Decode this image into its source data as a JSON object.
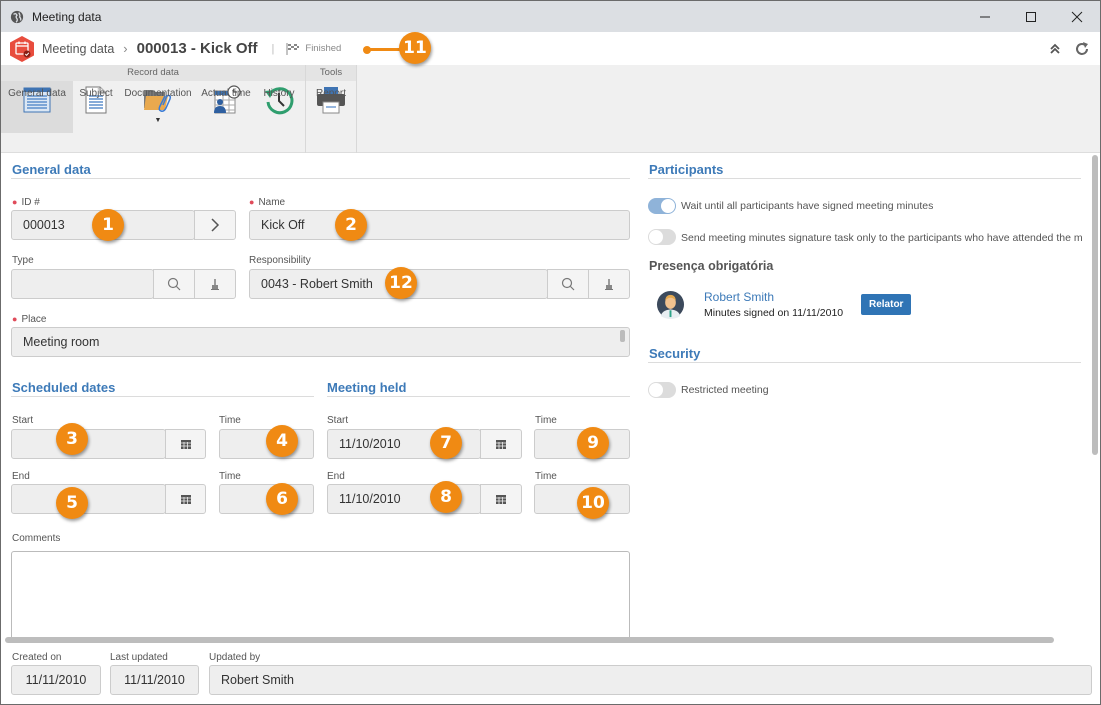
{
  "window": {
    "title": "Meeting data",
    "controls": [
      "minimize",
      "maximize",
      "close"
    ]
  },
  "header": {
    "breadcrumb": "Meeting data",
    "record_title": "000013 - Kick Off",
    "status": "Finished"
  },
  "ribbon": {
    "groups": [
      {
        "title": "Record data",
        "items": [
          {
            "label": "General data",
            "icon": "form-icon",
            "active": true
          },
          {
            "label": "Subject",
            "icon": "document-icon"
          },
          {
            "label": "Documentation",
            "icon": "folder-attachment-icon",
            "dropdown": true
          },
          {
            "label": "Actual time",
            "icon": "schedule-user-icon"
          },
          {
            "label": "History",
            "icon": "history-icon"
          }
        ]
      },
      {
        "title": "Tools",
        "items": [
          {
            "label": "Report",
            "icon": "printer-icon"
          }
        ]
      }
    ]
  },
  "general": {
    "section_title": "General data",
    "id_label": "ID #",
    "id_value": "000013",
    "name_label": "Name",
    "name_value": "Kick Off",
    "type_label": "Type",
    "type_value": "",
    "responsibility_label": "Responsibility",
    "responsibility_value": "0043 - Robert Smith",
    "place_label": "Place",
    "place_value": "Meeting room"
  },
  "scheduled": {
    "section_title": "Scheduled dates",
    "start_label": "Start",
    "start_value": "",
    "start_time_label": "Time",
    "start_time_value": "",
    "end_label": "End",
    "end_value": "",
    "end_time_label": "Time",
    "end_time_value": ""
  },
  "held": {
    "section_title": "Meeting held",
    "start_label": "Start",
    "start_value": "11/10/2010",
    "start_time_label": "Time",
    "start_time_value": "",
    "end_label": "End",
    "end_value": "11/10/2010",
    "end_time_label": "Time",
    "end_time_value": ""
  },
  "comments": {
    "label": "Comments",
    "value": ""
  },
  "participants": {
    "section_title": "Participants",
    "toggle_wait_label": "Wait until all participants have signed meeting minutes",
    "toggle_wait_on": true,
    "toggle_send_label": "Send meeting minutes signature task only to the participants who have attended the m",
    "toggle_send_on": false,
    "required_title": "Presença obrigatória",
    "person_name": "Robert Smith",
    "person_status": "Minutes signed on 11/11/2010",
    "person_role": "Relator"
  },
  "security": {
    "section_title": "Security",
    "restricted_label": "Restricted meeting",
    "restricted_on": false
  },
  "footer": {
    "created_label": "Created on",
    "created_value": "11/11/2010",
    "updated_label": "Last updated",
    "updated_value": "11/11/2010",
    "updated_by_label": "Updated by",
    "updated_by_value": "Robert Smith"
  },
  "annotations": [
    "1",
    "2",
    "3",
    "4",
    "5",
    "6",
    "7",
    "8",
    "9",
    "10",
    "11",
    "12"
  ],
  "colors": {
    "accent": "#3d7ab8",
    "badge": "#f08a13",
    "role_badge": "#2f74b5",
    "required": "#e04b5a"
  }
}
